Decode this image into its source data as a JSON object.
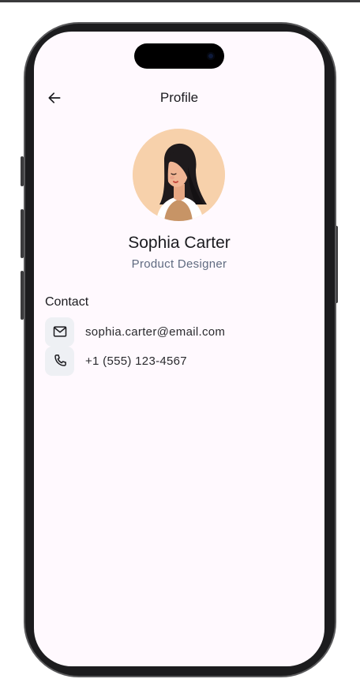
{
  "appbar": {
    "title": "Profile",
    "back_icon": "arrow-left-icon"
  },
  "profile": {
    "name": "Sophia Carter",
    "role": "Product Designer",
    "avatar_bg": "#f7d1ab"
  },
  "contact": {
    "title": "Contact",
    "items": [
      {
        "icon": "mail-icon",
        "label": "sophia.carter@email.com"
      },
      {
        "icon": "phone-icon",
        "label": "+1 (555) 123-4567"
      }
    ]
  },
  "colors": {
    "background": "#fff9fe",
    "text": "#1b1b1f",
    "muted": "#5f6b80",
    "icon_tile": "#eef0f4"
  }
}
